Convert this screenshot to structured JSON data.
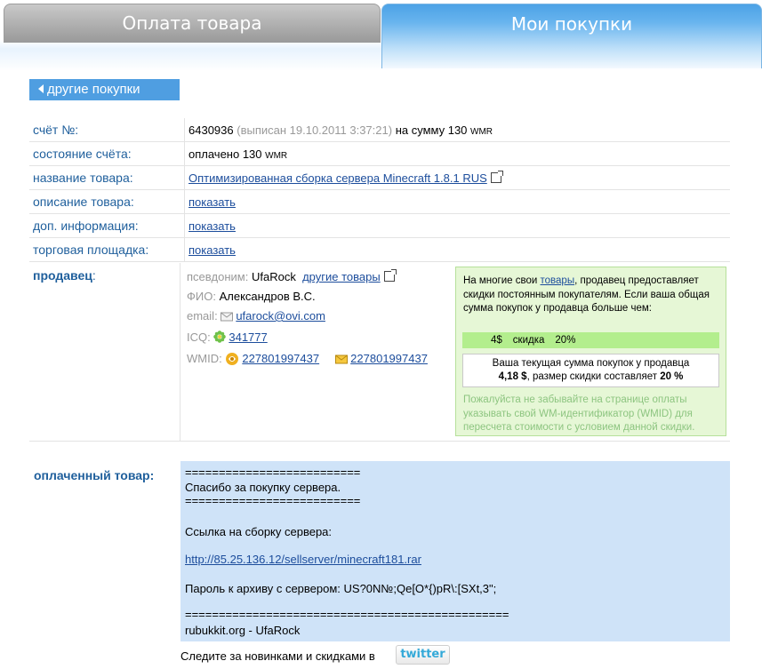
{
  "tabs": {
    "payment": "Оплата товара",
    "purchases": "Мои покупки"
  },
  "back_button": "другие покупки",
  "invoice": {
    "rows": [
      {
        "label": "счёт №:"
      },
      {
        "label": "состояние счёта:"
      },
      {
        "label": "название товара:"
      },
      {
        "label": "описание товара:"
      },
      {
        "label": "доп. информация:"
      },
      {
        "label": "торговая площадка:"
      }
    ],
    "number": "6430936",
    "issued": "(выписан 19.10.2011 3:37:21)",
    "sum_prefix": "на сумму 130",
    "currency": "WMR",
    "status": "оплачено 130",
    "product_name": "Оптимизированная сборка сервера Minecraft 1.8.1 RUS",
    "show": "показать"
  },
  "seller": {
    "label": "продавец",
    "nick_key": "псевдоним:",
    "nick": "UfaRock",
    "other_goods": "другие товары",
    "fio_key": "ФИО:",
    "fio": "Александров В.С.",
    "email_key": "email:",
    "email": "ufarock@ovi.com",
    "icq_key": "ICQ:",
    "icq": "341777",
    "wmid_key": "WMID:",
    "wmid": "227801997437",
    "wmid2": "227801997437"
  },
  "promo": {
    "text_before": "На многие свои ",
    "goods_link": "товары",
    "text_after": ", продавец предоставляет скидки постоянным покупателям. Если ваша общая сумма покупок у продавца больше чем:",
    "threshold": "4$",
    "discount_word": "скидка",
    "discount": "20%",
    "current_line1": "Ваша текущая сумма покупок у продавца",
    "current_amount": "4,18 $",
    "current_mid": ", размер скидки составляет",
    "current_discount": "20 %",
    "note": "Пожалуйста не забывайте на странице оплаты указывать свой WM-идентификатор (WMID) для пересчета стоимости с условием данной скидки."
  },
  "paid": {
    "label": "оплаченный товар:",
    "sep1": "==========================",
    "thanks": "Спасибо за покупку сервера.",
    "sep2": "==========================",
    "link_label": "Ссылка на сборку сервера:",
    "link": "http://85.25.136.12/sellserver/minecraft181.rar",
    "password": "Пароль к архиву с сервером: US?0N№;Qe[O*{)pR\\:[SXt,3\";",
    "sep3": "================================================",
    "signature": "rubukkit.org - UfaRock"
  },
  "footer": {
    "follow": "Следите за новинками и скидками в",
    "twitter": "twitter"
  },
  "colors": {
    "accent": "#4f9ee1",
    "label": "#1f5f9c",
    "promo_bg": "#e6f7d6",
    "paid_bg": "#cfe3f8"
  }
}
